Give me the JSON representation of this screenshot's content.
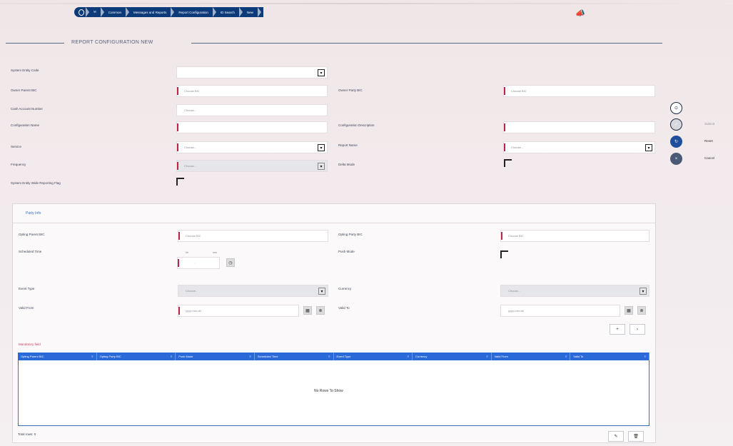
{
  "breadcrumb": [
    "Common",
    "Messages and Reports",
    "Report Configuration",
    "ID Search",
    "New"
  ],
  "notifications_icon": "megaphone-icon",
  "page_title": "REPORT CONFIGURATION NEW",
  "form": {
    "system_entity_code": {
      "label": "System Entity Code",
      "value": ""
    },
    "owner_parent_bic": {
      "label": "Owner Parent BIC",
      "placeholder": "Choose BIC"
    },
    "owner_party_bic": {
      "label": "Owner Party BIC",
      "placeholder": "Choose BIC"
    },
    "cash_account_number": {
      "label": "Cash Account Number",
      "placeholder": "Choose..."
    },
    "configuration_name": {
      "label": "Configuration Name",
      "value": ""
    },
    "configuration_description": {
      "label": "Configuration Description",
      "value": ""
    },
    "service": {
      "label": "Service",
      "placeholder": "Choose..."
    },
    "report_name": {
      "label": "Report Name",
      "placeholder": "Choose..."
    },
    "frequency": {
      "label": "Frequency",
      "placeholder": "Choose..."
    },
    "delta_mode": {
      "label": "Delta Mode"
    },
    "system_entity_wide_reporting_flag": {
      "label": "System Entity Wide Reporting Flag"
    }
  },
  "party_info": {
    "title": "Party Info",
    "opting_parent_bic": {
      "label": "Opting Parent BIC",
      "placeholder": "Choose BIC"
    },
    "opting_party_bic": {
      "label": "Opting Party BIC",
      "placeholder": "Choose BIC"
    },
    "scheduled_time": {
      "label": "Scheduled Time",
      "hh": "hh",
      "mm": "mm",
      "value": ":"
    },
    "push_mode": {
      "label": "Push Mode"
    },
    "event_type": {
      "label": "Event Type",
      "placeholder": "Choose..."
    },
    "currency": {
      "label": "Currency",
      "placeholder": "Choose..."
    },
    "valid_from": {
      "label": "Valid From",
      "placeholder": "yyyy-mm-dd"
    },
    "valid_to": {
      "label": "Valid To",
      "placeholder": "yyyy-mm-dd"
    },
    "mandatory_field": "Mandatory field",
    "grid_columns": [
      "Opting Parent BIC",
      "Opting Party BIC",
      "Push Mode",
      "Scheduled Time",
      "Event Type",
      "Currency",
      "Valid From",
      "Valid To"
    ],
    "no_rows": "No Rows To Show",
    "total_rows": "Total rows: 0"
  },
  "side_actions": {
    "submit": "Submit",
    "reset": "Reset",
    "cancel": "Cancel"
  }
}
